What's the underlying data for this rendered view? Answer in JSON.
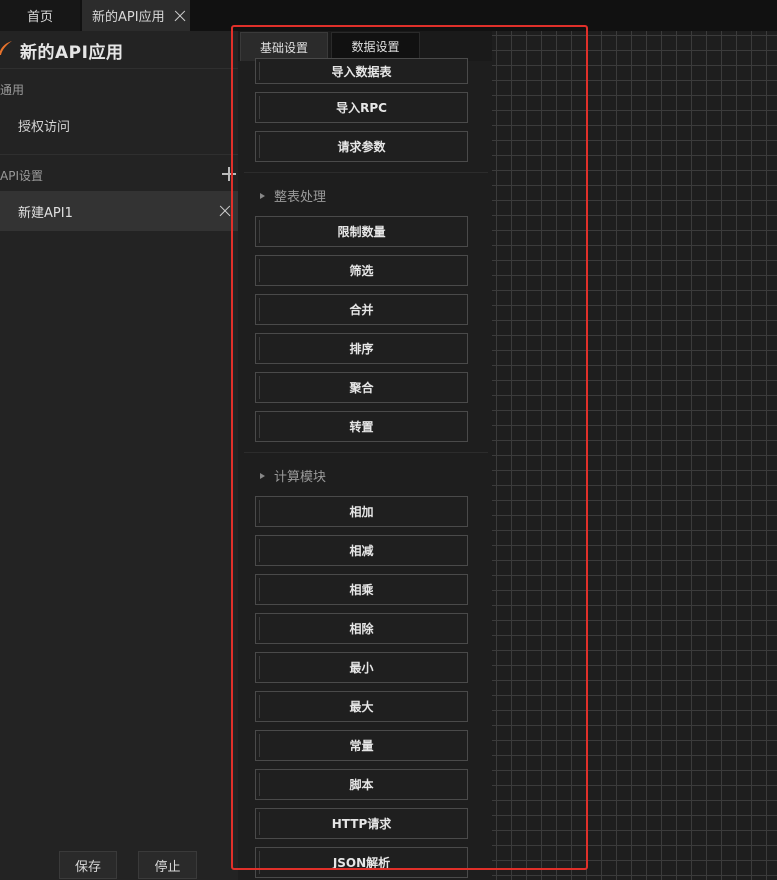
{
  "top_tabs": {
    "home": "首页",
    "app": "新的API应用"
  },
  "sidebar": {
    "app_title": "新的API应用",
    "general_label": "通用",
    "auth_item": "授权访问",
    "api_settings_label": "API设置",
    "api_item": "新建API1",
    "save_button": "保存",
    "stop_button": "停止"
  },
  "panel": {
    "tabs": [
      "基础设置",
      "数据设置"
    ],
    "top_buttons": [
      "导入数据表",
      "导入RPC",
      "请求参数"
    ],
    "group1": {
      "title": "整表处理",
      "buttons": [
        "限制数量",
        "筛选",
        "合并",
        "排序",
        "聚合",
        "转置"
      ]
    },
    "group2": {
      "title": "计算模块",
      "buttons": [
        "相加",
        "相减",
        "相乘",
        "相除",
        "最小",
        "最大",
        "常量",
        "脚本",
        "HTTP请求",
        "JSON解析"
      ]
    }
  },
  "colors": {
    "highlight": "#e0302a",
    "accent_icon": "#e8732c",
    "background": "#1c1c1c"
  }
}
